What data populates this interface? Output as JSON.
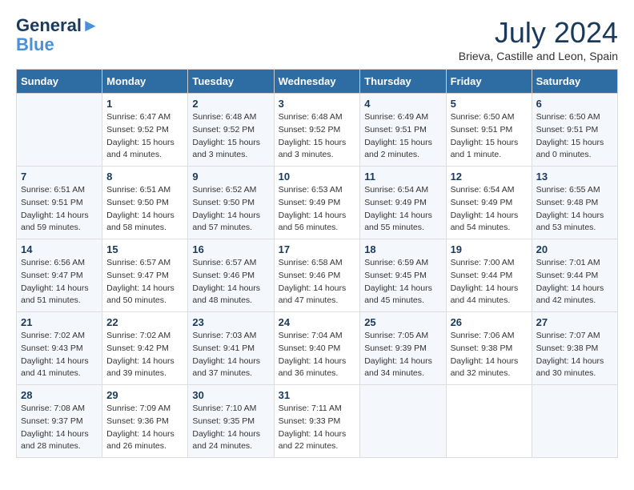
{
  "header": {
    "logo_line1": "General",
    "logo_line2": "Blue",
    "month_title": "July 2024",
    "location": "Brieva, Castille and Leon, Spain"
  },
  "days_of_week": [
    "Sunday",
    "Monday",
    "Tuesday",
    "Wednesday",
    "Thursday",
    "Friday",
    "Saturday"
  ],
  "weeks": [
    [
      {
        "day": "",
        "info": ""
      },
      {
        "day": "1",
        "info": "Sunrise: 6:47 AM\nSunset: 9:52 PM\nDaylight: 15 hours\nand 4 minutes."
      },
      {
        "day": "2",
        "info": "Sunrise: 6:48 AM\nSunset: 9:52 PM\nDaylight: 15 hours\nand 3 minutes."
      },
      {
        "day": "3",
        "info": "Sunrise: 6:48 AM\nSunset: 9:52 PM\nDaylight: 15 hours\nand 3 minutes."
      },
      {
        "day": "4",
        "info": "Sunrise: 6:49 AM\nSunset: 9:51 PM\nDaylight: 15 hours\nand 2 minutes."
      },
      {
        "day": "5",
        "info": "Sunrise: 6:50 AM\nSunset: 9:51 PM\nDaylight: 15 hours\nand 1 minute."
      },
      {
        "day": "6",
        "info": "Sunrise: 6:50 AM\nSunset: 9:51 PM\nDaylight: 15 hours\nand 0 minutes."
      }
    ],
    [
      {
        "day": "7",
        "info": "Sunrise: 6:51 AM\nSunset: 9:51 PM\nDaylight: 14 hours\nand 59 minutes."
      },
      {
        "day": "8",
        "info": "Sunrise: 6:51 AM\nSunset: 9:50 PM\nDaylight: 14 hours\nand 58 minutes."
      },
      {
        "day": "9",
        "info": "Sunrise: 6:52 AM\nSunset: 9:50 PM\nDaylight: 14 hours\nand 57 minutes."
      },
      {
        "day": "10",
        "info": "Sunrise: 6:53 AM\nSunset: 9:49 PM\nDaylight: 14 hours\nand 56 minutes."
      },
      {
        "day": "11",
        "info": "Sunrise: 6:54 AM\nSunset: 9:49 PM\nDaylight: 14 hours\nand 55 minutes."
      },
      {
        "day": "12",
        "info": "Sunrise: 6:54 AM\nSunset: 9:49 PM\nDaylight: 14 hours\nand 54 minutes."
      },
      {
        "day": "13",
        "info": "Sunrise: 6:55 AM\nSunset: 9:48 PM\nDaylight: 14 hours\nand 53 minutes."
      }
    ],
    [
      {
        "day": "14",
        "info": "Sunrise: 6:56 AM\nSunset: 9:47 PM\nDaylight: 14 hours\nand 51 minutes."
      },
      {
        "day": "15",
        "info": "Sunrise: 6:57 AM\nSunset: 9:47 PM\nDaylight: 14 hours\nand 50 minutes."
      },
      {
        "day": "16",
        "info": "Sunrise: 6:57 AM\nSunset: 9:46 PM\nDaylight: 14 hours\nand 48 minutes."
      },
      {
        "day": "17",
        "info": "Sunrise: 6:58 AM\nSunset: 9:46 PM\nDaylight: 14 hours\nand 47 minutes."
      },
      {
        "day": "18",
        "info": "Sunrise: 6:59 AM\nSunset: 9:45 PM\nDaylight: 14 hours\nand 45 minutes."
      },
      {
        "day": "19",
        "info": "Sunrise: 7:00 AM\nSunset: 9:44 PM\nDaylight: 14 hours\nand 44 minutes."
      },
      {
        "day": "20",
        "info": "Sunrise: 7:01 AM\nSunset: 9:44 PM\nDaylight: 14 hours\nand 42 minutes."
      }
    ],
    [
      {
        "day": "21",
        "info": "Sunrise: 7:02 AM\nSunset: 9:43 PM\nDaylight: 14 hours\nand 41 minutes."
      },
      {
        "day": "22",
        "info": "Sunrise: 7:02 AM\nSunset: 9:42 PM\nDaylight: 14 hours\nand 39 minutes."
      },
      {
        "day": "23",
        "info": "Sunrise: 7:03 AM\nSunset: 9:41 PM\nDaylight: 14 hours\nand 37 minutes."
      },
      {
        "day": "24",
        "info": "Sunrise: 7:04 AM\nSunset: 9:40 PM\nDaylight: 14 hours\nand 36 minutes."
      },
      {
        "day": "25",
        "info": "Sunrise: 7:05 AM\nSunset: 9:39 PM\nDaylight: 14 hours\nand 34 minutes."
      },
      {
        "day": "26",
        "info": "Sunrise: 7:06 AM\nSunset: 9:38 PM\nDaylight: 14 hours\nand 32 minutes."
      },
      {
        "day": "27",
        "info": "Sunrise: 7:07 AM\nSunset: 9:38 PM\nDaylight: 14 hours\nand 30 minutes."
      }
    ],
    [
      {
        "day": "28",
        "info": "Sunrise: 7:08 AM\nSunset: 9:37 PM\nDaylight: 14 hours\nand 28 minutes."
      },
      {
        "day": "29",
        "info": "Sunrise: 7:09 AM\nSunset: 9:36 PM\nDaylight: 14 hours\nand 26 minutes."
      },
      {
        "day": "30",
        "info": "Sunrise: 7:10 AM\nSunset: 9:35 PM\nDaylight: 14 hours\nand 24 minutes."
      },
      {
        "day": "31",
        "info": "Sunrise: 7:11 AM\nSunset: 9:33 PM\nDaylight: 14 hours\nand 22 minutes."
      },
      {
        "day": "",
        "info": ""
      },
      {
        "day": "",
        "info": ""
      },
      {
        "day": "",
        "info": ""
      }
    ]
  ]
}
